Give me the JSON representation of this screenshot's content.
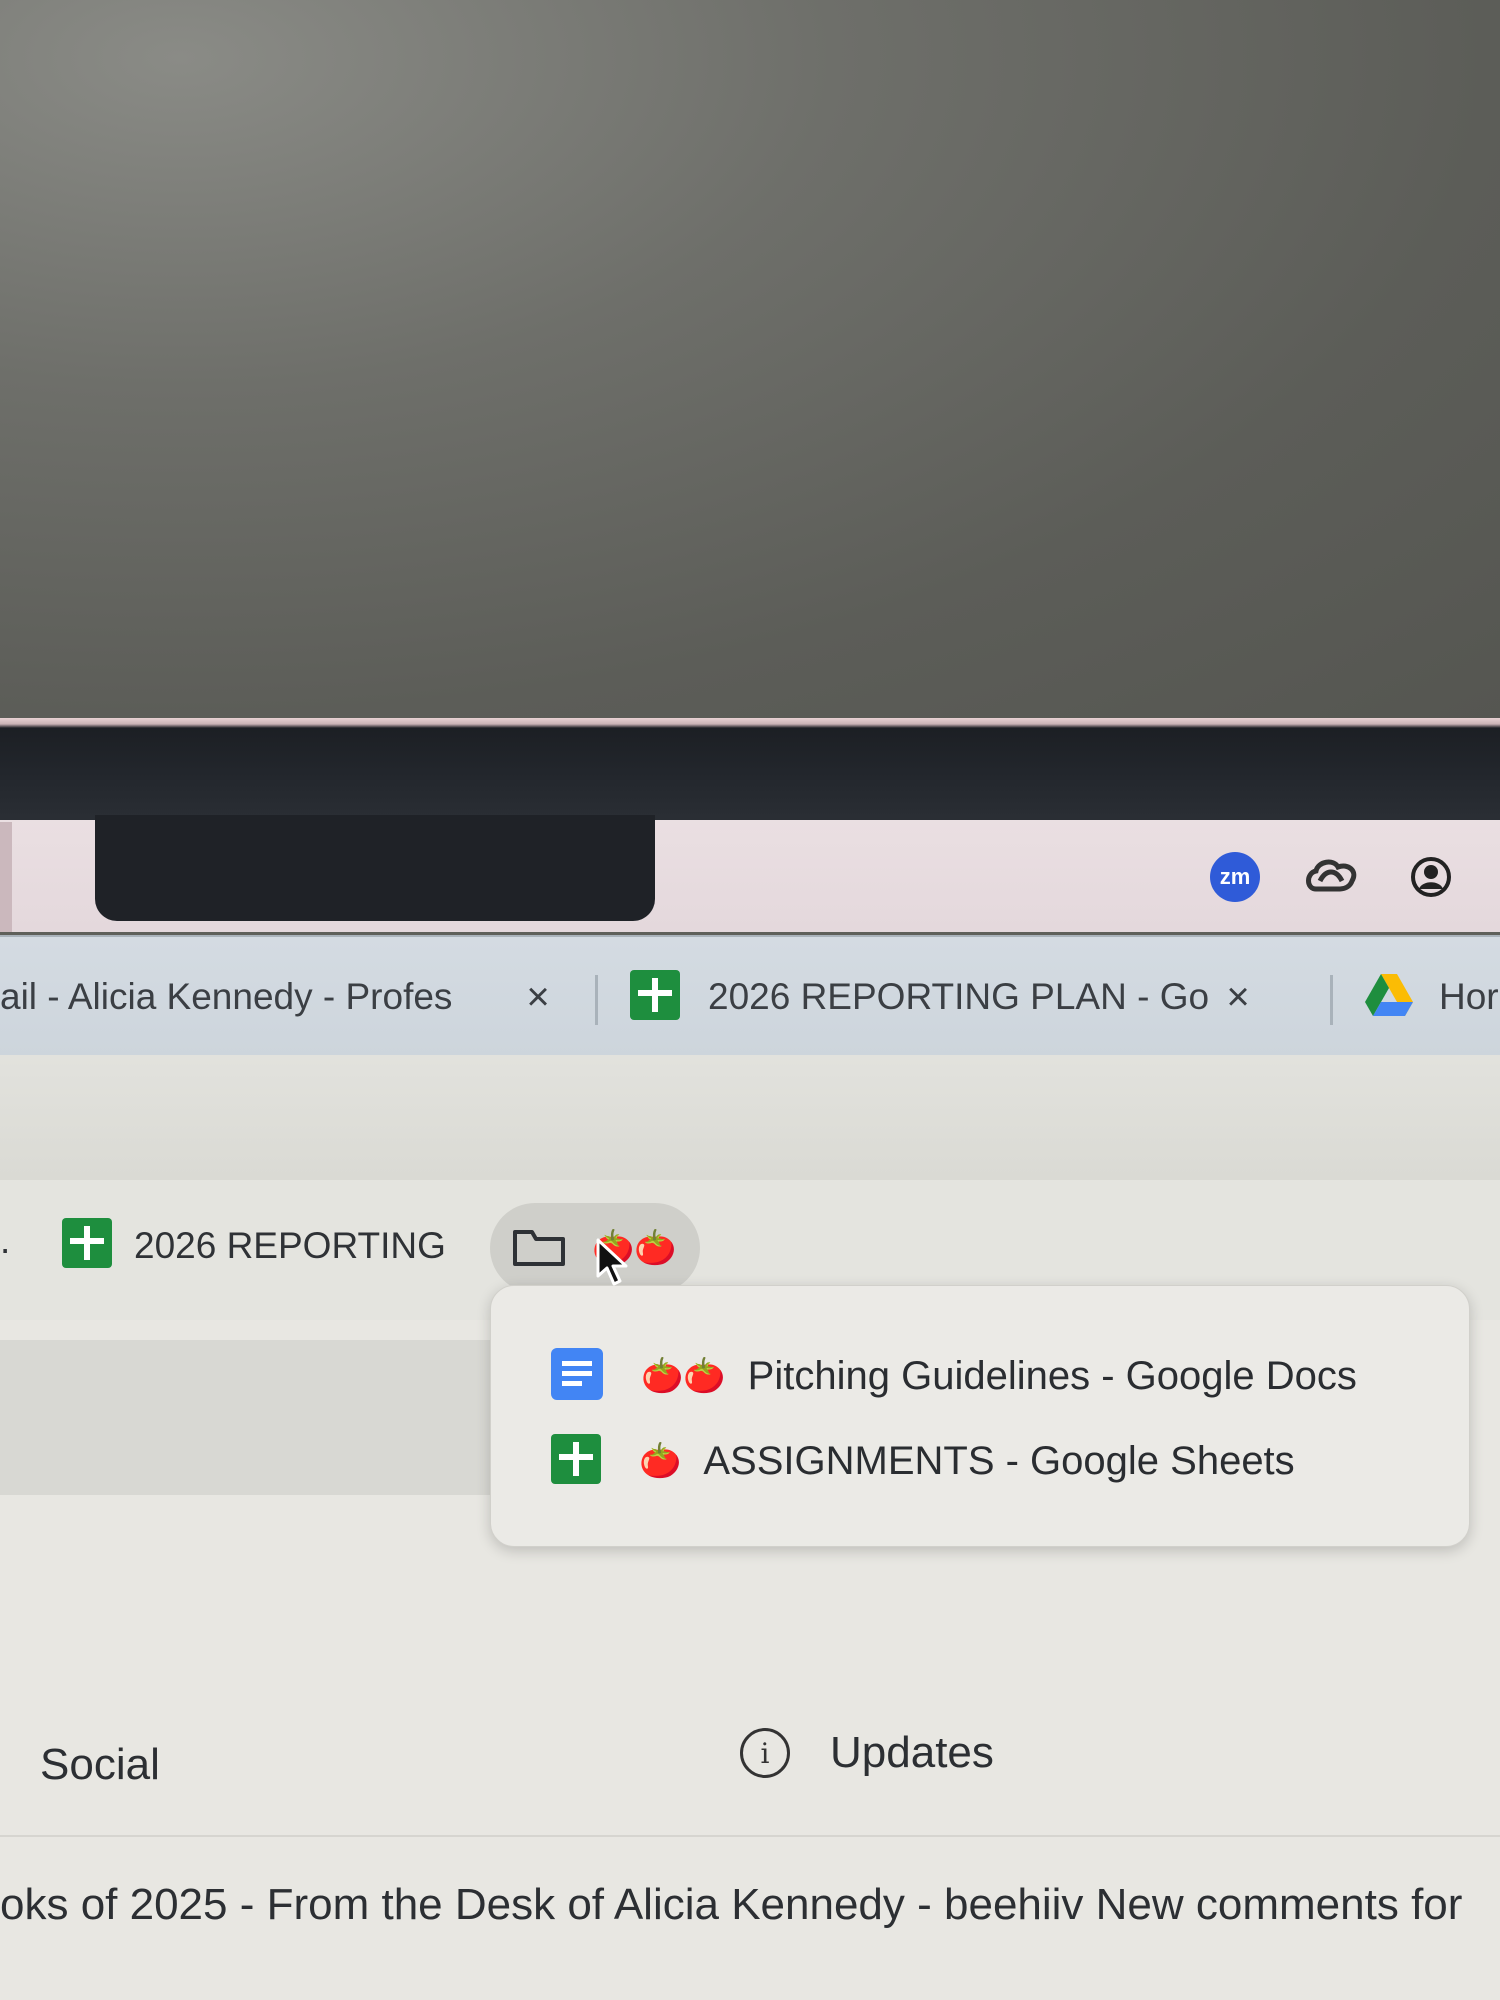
{
  "menubar": {
    "status_icons": [
      "zoom-icon",
      "creative-cloud-icon",
      "user-account-icon"
    ],
    "zoom_label": "zm"
  },
  "tabs": [
    {
      "title": "ail - Alicia Kennedy - Profes",
      "close": "×",
      "icon": "gmail-icon"
    },
    {
      "title": "2026 REPORTING PLAN - Go",
      "close": "×",
      "icon": "google-sheets-icon"
    },
    {
      "title": "Hor",
      "icon": "google-drive-icon"
    }
  ],
  "bookmarks": {
    "leading_dot": ".",
    "items": [
      {
        "label": "2026 REPORTING",
        "icon": "google-sheets-icon"
      }
    ],
    "folder": {
      "icon": "folder-icon",
      "label": "🍅🍅"
    }
  },
  "dropdown": {
    "items": [
      {
        "emoji": "🍅🍅",
        "label": "Pitching Guidelines - Google Docs",
        "icon": "google-docs-icon"
      },
      {
        "emoji": "🍅",
        "label": "ASSIGNMENTS - Google Sheets",
        "icon": "google-sheets-icon"
      }
    ]
  },
  "inbox": {
    "categories": [
      {
        "label": "Social"
      },
      {
        "label": "Updates",
        "icon": "info-icon"
      }
    ],
    "row_text": "oks of 2025 - From the Desk of Alicia Kennedy - beehiiv New comments for"
  },
  "colors": {
    "sheets_green": "#1e8e3e",
    "docs_blue": "#4285f4",
    "zoom_blue": "#2f5bd8"
  }
}
